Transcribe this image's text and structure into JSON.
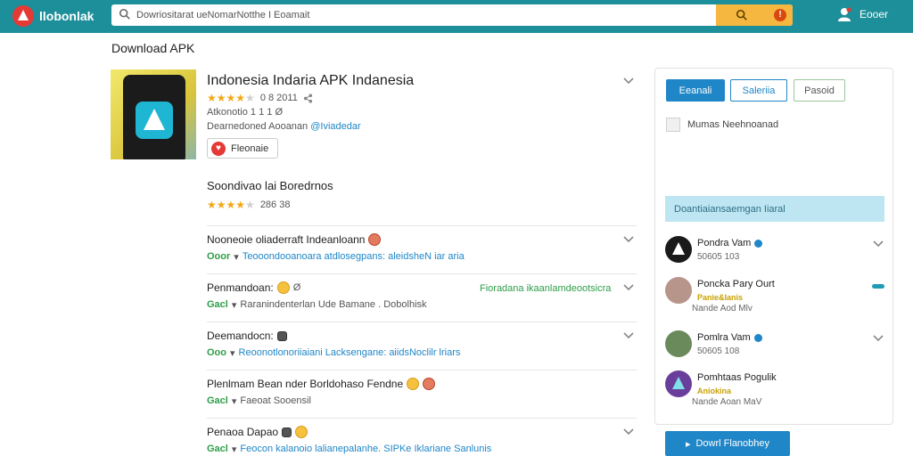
{
  "header": {
    "logo_text": "llobonlak",
    "search_value": "Dowriositarat ueNomarNotthe I Eoamait",
    "right_label": "Eooer"
  },
  "page": {
    "title": "Download APK"
  },
  "app": {
    "name": "Indonesia Indaria APK Indanesia",
    "rating_text": "0 8 2011",
    "line2": "Atkonotio 1 1 1 Ø",
    "line3_prefix": "Dearnedoned Aooanan",
    "line3_link": "@Iviadedar",
    "fav_label": "Fleonaie",
    "rating_value": 3.5
  },
  "reviews_section": {
    "title": "Soondivao lai Boredrnos",
    "rating_text": "286 38",
    "rating_value": 3.5
  },
  "reviews": [
    {
      "title": "Nooneoie oliaderraft Indeanloann",
      "emoji": "red",
      "tag": "Ooor",
      "sub_text": "Teooondooanoara atdlosegpans: aleidsheN iar aria",
      "right": ""
    },
    {
      "title": "Penmandoan:",
      "emoji": "smile",
      "tag": "Gacl",
      "sub_text": "Raranindenterlan Ude Bamane . Dobolhisk",
      "right": "Fioradana ikaanlamdeootsicra"
    },
    {
      "title": "Deemandocn:",
      "emoji": "box",
      "tag": "Ooo",
      "sub_text": "Reoonotlonoriiaiani Lacksengane: aiidsNoclilr lriars",
      "right": ""
    },
    {
      "title": "Plenlmam Bean nder Borldohaso Fendne",
      "emoji": "smile-red",
      "tag": "Gacl",
      "sub_text": "Faeoat Sooensil",
      "right": ""
    },
    {
      "title": "Penaoa Dapao",
      "emoji": "box-smile",
      "tag": "Gacl",
      "sub_text": "Feocon kalanoio lalianepalanhe. SIPKe Iklariane Sanlunis",
      "right": ""
    }
  ],
  "sidebar": {
    "tabs": [
      "Eeanali",
      "Saleriia",
      "Pasoid"
    ],
    "info": "Mumas Neehnoanad",
    "banner": "Doantiaiansaemgan Iiaral",
    "items": [
      {
        "name": "Pondra Vam",
        "meta": "50605 103",
        "meta2": ""
      },
      {
        "name": "Poncka Pary Ourt",
        "meta": "Panie&Ianis",
        "meta2": "Nande Aod    Mlv"
      },
      {
        "name": "Pomlra Vam",
        "meta": "50605 108",
        "meta2": ""
      },
      {
        "name": "Pomhtaas Pogulik",
        "meta": "Aniokina",
        "meta2": "Nande Aoan   MaV"
      }
    ]
  },
  "cta": {
    "label": "Dowrl Flanobhey"
  },
  "colors": {
    "topbar": "#1d8f9a",
    "accent": "#1f86c7",
    "search_button": "#f5b740",
    "star": "#f3a712",
    "positive": "#2e9e48"
  }
}
